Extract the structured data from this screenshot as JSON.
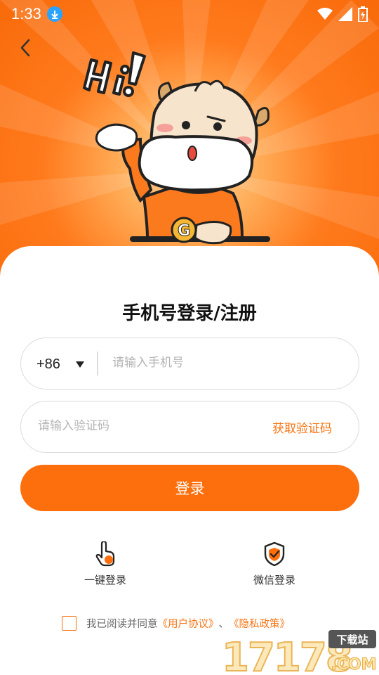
{
  "status_bar": {
    "time": "1:33"
  },
  "title": "手机号登录/注册",
  "phone": {
    "country_code": "+86",
    "placeholder": "请输入手机号",
    "value": ""
  },
  "code": {
    "placeholder": "请输入验证码",
    "value": "",
    "get_code_label": "获取验证码"
  },
  "login_button": "登录",
  "alt_logins": [
    {
      "label": "一键登录",
      "icon": "touch-icon"
    },
    {
      "label": "微信登录",
      "icon": "shield-icon"
    }
  ],
  "agreement": {
    "prefix": "我已阅读并同意",
    "user_agreement": "《用户协议》",
    "separator": "、",
    "privacy_policy": "《隐私政策》"
  },
  "watermark": {
    "number": "17178",
    "tag": "下载站",
    "domain": ".COM"
  },
  "colors": {
    "accent": "#fc6f0c",
    "accent_text": "#f77312",
    "hero_bg": "#f86a0a"
  }
}
